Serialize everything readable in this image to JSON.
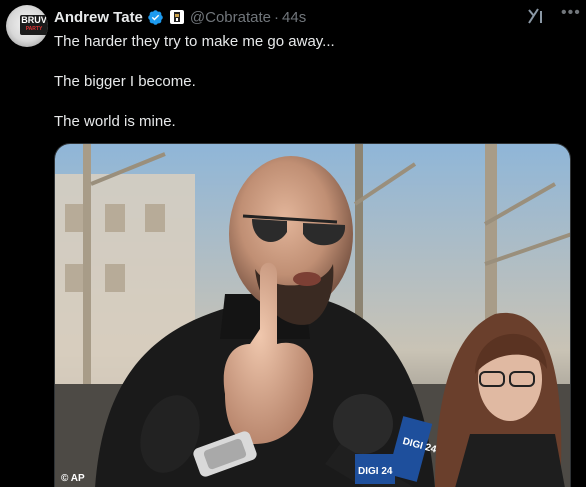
{
  "author": {
    "name": "Andrew Tate",
    "handle": "@Cobratate",
    "time": "44s",
    "avatar_text": "BRUV",
    "avatar_subtext": "PARTY"
  },
  "tweet": {
    "lines": [
      "The harder they try to make me go away...",
      "The bigger I become.",
      "The world is mine."
    ]
  },
  "media": {
    "credit": "© AP",
    "mic_label": "DIGI 24",
    "mic_label_2": "DIGI 24"
  },
  "icons": {
    "verified": "verified-badge-icon",
    "affiliate": "affiliate-badge-icon",
    "grok": "grok-icon",
    "more": "more-icon"
  },
  "colors": {
    "background": "#000000",
    "text": "#e7e9ea",
    "muted": "#71767b",
    "verified": "#1d9bf0"
  }
}
